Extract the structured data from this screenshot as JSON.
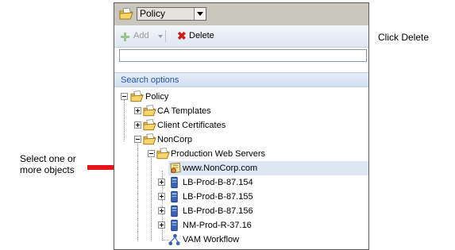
{
  "header": {
    "select_value": "Policy"
  },
  "toolbar": {
    "add_label": "Add",
    "delete_label": "Delete"
  },
  "search": {
    "value": ""
  },
  "search_options_label": "Search options",
  "tree": {
    "root": "Policy",
    "ca_templates": "CA Templates",
    "client_certificates": "Client Certificates",
    "noncorp": "NonCorp",
    "production_web_servers": "Production Web Servers",
    "www_noncorp": "www.NonCorp.com",
    "server1": "LB-Prod-B-87.154",
    "server2": "LB-Prod-B-87.155",
    "server3": "LB-Prod-B-87.156",
    "server4": "NM-Prod-R-37.16",
    "workflow": "VAM Workflow"
  },
  "annotations": {
    "click_delete": "Click Delete",
    "select_line1": "Select one or",
    "select_line2": "more objects"
  },
  "colors": {
    "arrow": "#e8141c",
    "selected_row": "#dde7f3"
  }
}
